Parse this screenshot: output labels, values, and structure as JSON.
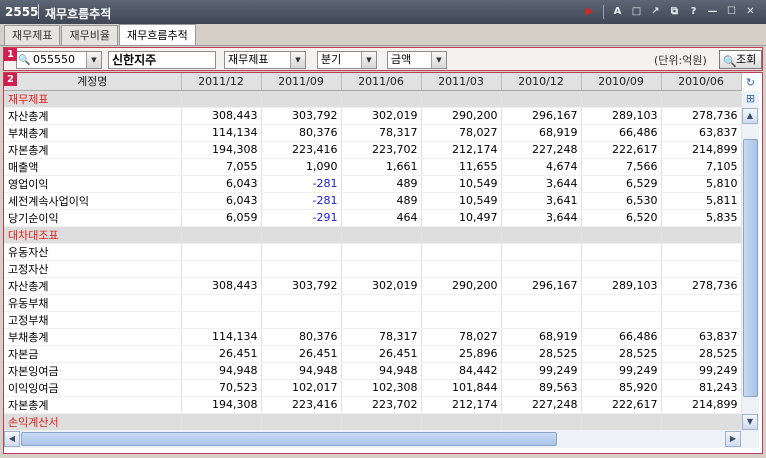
{
  "window": {
    "code": "2555",
    "title": "재무흐름추적"
  },
  "titlebar_icons": [
    "play-icon",
    "font-icon",
    "window-icon",
    "popout-icon",
    "restore-icon",
    "help-icon",
    "minimize-icon",
    "maximize-icon",
    "close-icon"
  ],
  "tabs": [
    {
      "label": "재무제표",
      "active": false
    },
    {
      "label": "재무비율",
      "active": false
    },
    {
      "label": "재무흐름추적",
      "active": true
    }
  ],
  "badges": {
    "toolbar": "1",
    "grid": "2"
  },
  "toolbar": {
    "stock_code": "055550",
    "stock_name": "신한지주",
    "statement_type": "재무제표",
    "period": "분기",
    "value_type": "금액",
    "unit": "(단위:억원)",
    "query_label": "조회"
  },
  "grid": {
    "headers": [
      "계정명",
      "2011/12",
      "2011/09",
      "2011/06",
      "2011/03",
      "2010/12",
      "2010/09",
      "2010/06"
    ],
    "rows": [
      {
        "section": true,
        "name": "재무제표",
        "values": [
          "",
          "",
          "",
          "",
          "",
          "",
          ""
        ]
      },
      {
        "name": "자산총계",
        "values": [
          "308,443",
          "303,792",
          "302,019",
          "290,200",
          "296,167",
          "289,103",
          "278,736"
        ]
      },
      {
        "name": "부채총계",
        "values": [
          "114,134",
          "80,376",
          "78,317",
          "78,027",
          "68,919",
          "66,486",
          "63,837"
        ]
      },
      {
        "name": "자본총계",
        "values": [
          "194,308",
          "223,416",
          "223,702",
          "212,174",
          "227,248",
          "222,617",
          "214,899"
        ]
      },
      {
        "name": "매출액",
        "values": [
          "7,055",
          "1,090",
          "1,661",
          "11,655",
          "4,674",
          "7,566",
          "7,105"
        ]
      },
      {
        "name": "영업이익",
        "values": [
          "6,043",
          "-281",
          "489",
          "10,549",
          "3,644",
          "6,529",
          "5,810"
        ]
      },
      {
        "name": "세전계속사업이익",
        "values": [
          "6,043",
          "-281",
          "489",
          "10,549",
          "3,641",
          "6,530",
          "5,811"
        ]
      },
      {
        "name": "당기순이익",
        "values": [
          "6,059",
          "-291",
          "464",
          "10,497",
          "3,644",
          "6,520",
          "5,835"
        ]
      },
      {
        "section": true,
        "name": "대차대조표",
        "values": [
          "",
          "",
          "",
          "",
          "",
          "",
          ""
        ]
      },
      {
        "name": "유동자산",
        "values": [
          "",
          "",
          "",
          "",
          "",
          "",
          ""
        ]
      },
      {
        "name": "고정자산",
        "values": [
          "",
          "",
          "",
          "",
          "",
          "",
          ""
        ]
      },
      {
        "name": "자산총계",
        "values": [
          "308,443",
          "303,792",
          "302,019",
          "290,200",
          "296,167",
          "289,103",
          "278,736"
        ]
      },
      {
        "name": "유동부채",
        "values": [
          "",
          "",
          "",
          "",
          "",
          "",
          ""
        ]
      },
      {
        "name": "고정부채",
        "values": [
          "",
          "",
          "",
          "",
          "",
          "",
          ""
        ]
      },
      {
        "name": "부채총계",
        "values": [
          "114,134",
          "80,376",
          "78,317",
          "78,027",
          "68,919",
          "66,486",
          "63,837"
        ]
      },
      {
        "name": "자본금",
        "values": [
          "26,451",
          "26,451",
          "26,451",
          "25,896",
          "28,525",
          "28,525",
          "28,525"
        ]
      },
      {
        "name": "자본잉여금",
        "values": [
          "94,948",
          "94,948",
          "94,948",
          "84,442",
          "99,249",
          "99,249",
          "99,249"
        ]
      },
      {
        "name": "이익잉여금",
        "values": [
          "70,523",
          "102,017",
          "102,308",
          "101,844",
          "89,563",
          "85,920",
          "81,243"
        ]
      },
      {
        "name": "자본총계",
        "values": [
          "194,308",
          "223,416",
          "223,702",
          "212,174",
          "227,248",
          "222,617",
          "214,899"
        ]
      },
      {
        "section": true,
        "name": "손익계산서",
        "values": [
          "",
          "",
          "",
          "",
          "",
          "",
          ""
        ]
      }
    ]
  },
  "colors": {
    "section_text": "#e0201e",
    "negative_text": "#1a1ae0",
    "badge": "#d01e4e",
    "titlebar": "#4a5262"
  }
}
